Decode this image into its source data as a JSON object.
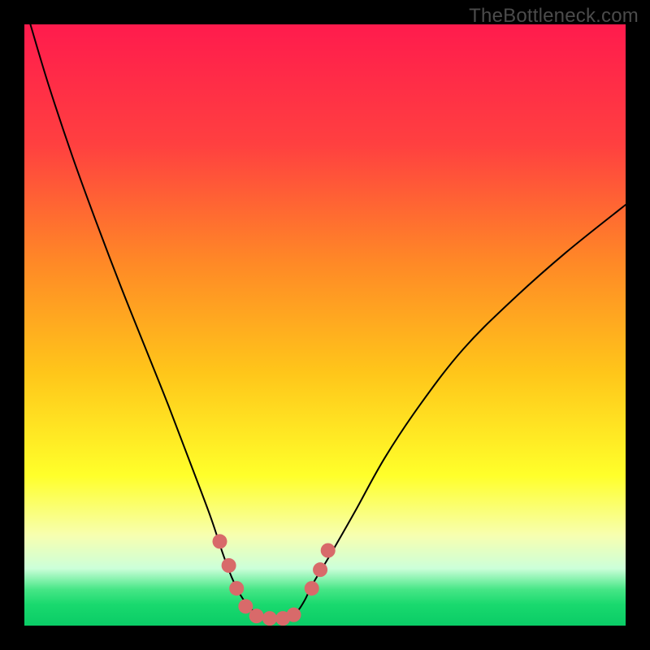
{
  "watermark": "TheBottleneck.com",
  "chart_data": {
    "type": "line",
    "title": "",
    "xlabel": "",
    "ylabel": "",
    "xlim": [
      0,
      100
    ],
    "ylim": [
      0,
      100
    ],
    "background_gradient_stops": [
      {
        "offset": 0.0,
        "color": "#ff1b4d"
      },
      {
        "offset": 0.2,
        "color": "#ff4040"
      },
      {
        "offset": 0.4,
        "color": "#ff8a26"
      },
      {
        "offset": 0.58,
        "color": "#ffc61a"
      },
      {
        "offset": 0.75,
        "color": "#ffff2a"
      },
      {
        "offset": 0.85,
        "color": "#f7ffb0"
      },
      {
        "offset": 0.905,
        "color": "#ccffd9"
      },
      {
        "offset": 0.94,
        "color": "#46e686"
      },
      {
        "offset": 0.965,
        "color": "#19d96e"
      },
      {
        "offset": 1.0,
        "color": "#0acc66"
      }
    ],
    "series": [
      {
        "name": "bottleneck-curve",
        "stroke": "#000000",
        "stroke_width": 2.0,
        "x": [
          1,
          4,
          8,
          12,
          16,
          20,
          24,
          28,
          31,
          33,
          34.5,
          36,
          37.5,
          39,
          41,
          43,
          45,
          46.5,
          48,
          51,
          55,
          60,
          66,
          73,
          81,
          90,
          100
        ],
        "y": [
          100,
          90,
          78,
          67,
          56.5,
          46.5,
          36.5,
          26,
          18,
          12,
          8,
          5,
          3,
          1.8,
          1.2,
          1.2,
          2,
          4,
          7,
          12,
          19,
          28,
          37,
          46,
          54,
          62,
          70
        ]
      }
    ],
    "markers": {
      "name": "test-points",
      "color": "#d86a6a",
      "radius": 9,
      "points": [
        {
          "x": 32.5,
          "y": 14
        },
        {
          "x": 34.0,
          "y": 10
        },
        {
          "x": 35.3,
          "y": 6.2
        },
        {
          "x": 36.8,
          "y": 3.2
        },
        {
          "x": 38.6,
          "y": 1.6
        },
        {
          "x": 40.8,
          "y": 1.2
        },
        {
          "x": 43.0,
          "y": 1.2
        },
        {
          "x": 44.8,
          "y": 1.8
        },
        {
          "x": 47.8,
          "y": 6.2
        },
        {
          "x": 49.2,
          "y": 9.3
        },
        {
          "x": 50.5,
          "y": 12.5
        }
      ]
    }
  }
}
